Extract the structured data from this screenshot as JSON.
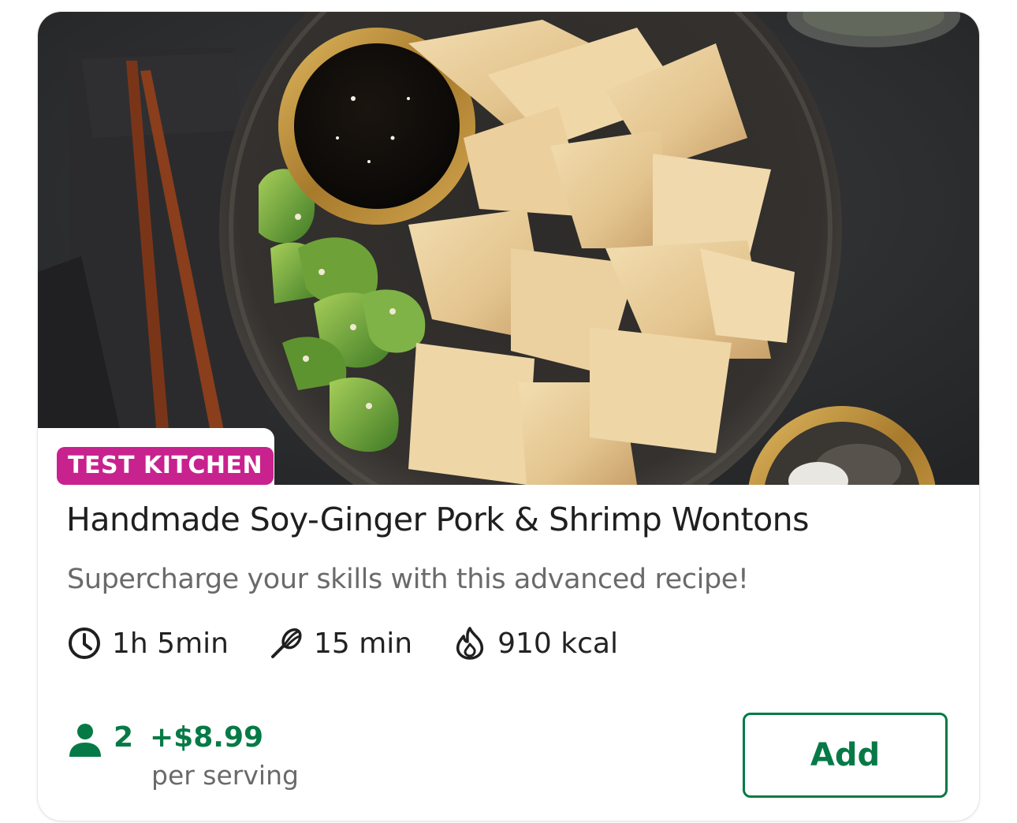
{
  "recipe": {
    "badge": "TEST KITCHEN",
    "title": "Handmade Soy-Ginger Pork & Shrimp Wontons",
    "subtitle": "Supercharge your skills with this advanced recipe!",
    "image_alt": "Wontons on a dark plate with soy dipping sauce, smashed cucumber and chopsticks"
  },
  "meta": {
    "total_time": "1h 5min",
    "prep_time": "15 min",
    "calories": "910 kcal",
    "icons": [
      "clock-icon",
      "whisk-icon",
      "flame-icon"
    ]
  },
  "pricing": {
    "servings": "2",
    "price": "+$8.99",
    "unit": "per serving"
  },
  "actions": {
    "add_label": "Add"
  },
  "colors": {
    "brand_green": "#067a46",
    "badge_magenta": "#c8228f",
    "title_text": "#1f1f1f",
    "muted_text": "#6a6a6a"
  }
}
